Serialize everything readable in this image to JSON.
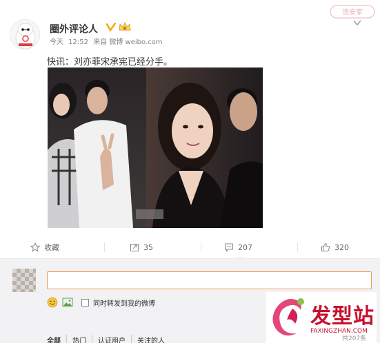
{
  "stamp": "流安家",
  "post": {
    "username": "圈外评论人",
    "meta": {
      "day": "今天",
      "time": "12:52",
      "source": "来自 微博 weibo.com"
    },
    "text": "快讯：刘亦菲宋承宪已经分手。"
  },
  "actions": {
    "favorite": "收藏",
    "repost": "35",
    "comment": "207",
    "like": "320"
  },
  "comment_box": {
    "placeholder": "",
    "repost_label": "同时转发到我的微博"
  },
  "tabs": [
    "全部",
    "热门",
    "认证用户",
    "关注的人"
  ],
  "watermark": {
    "brand": "发型站",
    "url": "FAXINGZHAN.COM",
    "count": "共207条"
  },
  "colors": {
    "accent": "#f19b4c",
    "brand": "#c8102e",
    "text": "#333333",
    "muted": "#808080"
  }
}
